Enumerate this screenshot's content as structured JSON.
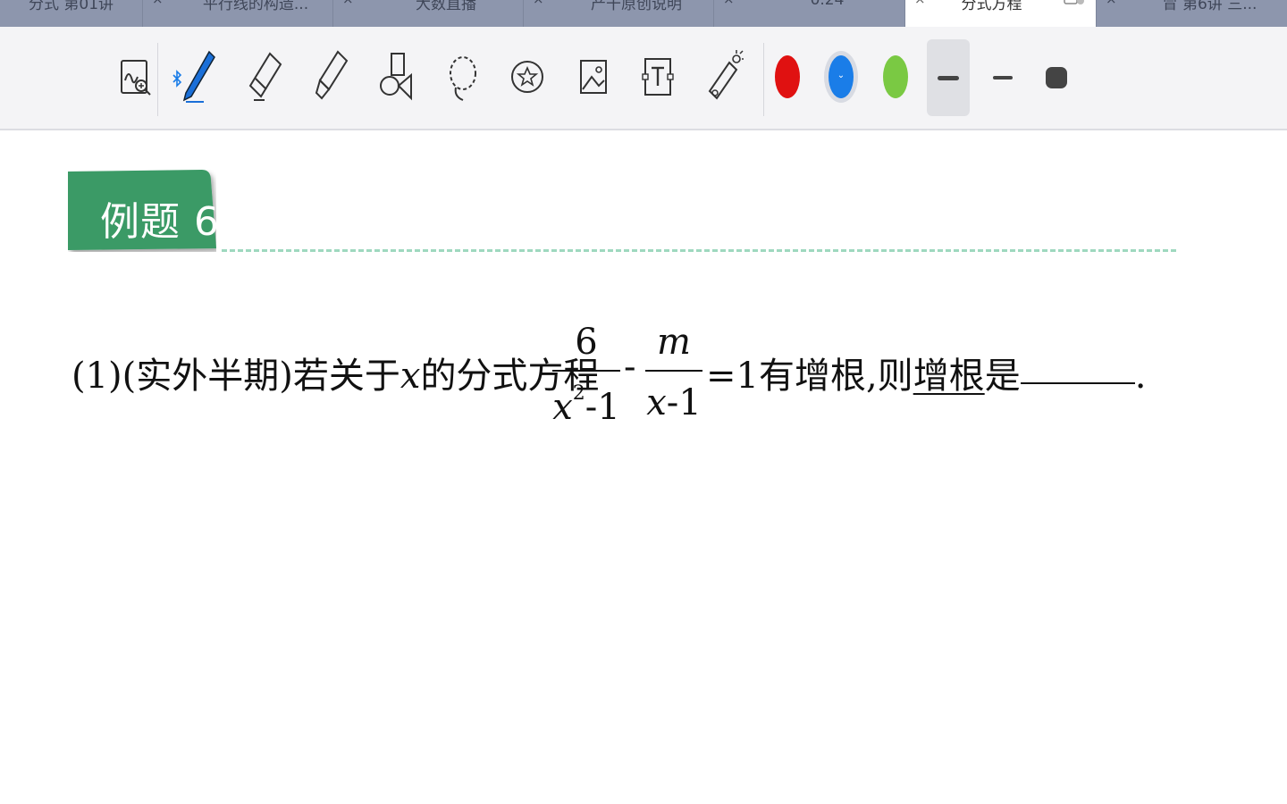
{
  "tabs": [
    {
      "label": "分式 第01讲",
      "close": "×"
    },
    {
      "label": "平行线的构造...",
      "close": "×"
    },
    {
      "label": "大数直播",
      "close": "×"
    },
    {
      "label": "产干原创说明",
      "close": "×"
    },
    {
      "label": "0.24",
      "close": "×"
    },
    {
      "label": "分式方程",
      "close": "×",
      "active": true
    },
    {
      "label": "冒 第6讲 三...",
      "close": "×"
    }
  ],
  "toolbar": {
    "tools": [
      {
        "name": "magnify-handwriting-icon"
      },
      {
        "name": "pen-icon"
      },
      {
        "name": "eraser-icon"
      },
      {
        "name": "highlighter-icon"
      },
      {
        "name": "shapes-icon"
      },
      {
        "name": "lasso-icon"
      },
      {
        "name": "sticker-icon"
      },
      {
        "name": "image-icon"
      },
      {
        "name": "text-box-icon"
      },
      {
        "name": "laser-pointer-icon"
      }
    ],
    "colors": [
      "#e01111",
      "#1a7de8",
      "#7ac943"
    ],
    "selected_color_mark": "⌄",
    "stroke_colors": {
      "bar": "#444444"
    }
  },
  "document": {
    "banner": {
      "text": "例题 6",
      "color": "#3a9a66"
    },
    "problem": {
      "prefix": "(1)(实外半期)若关于",
      "var_x": "x",
      "mid": "的分式方程",
      "frac1_num": "6",
      "frac1_den_var": "x",
      "frac1_den_sup": "2",
      "frac1_den_rest": "-1",
      "minus": "-",
      "frac2_num": "m",
      "frac2_den_var": "x",
      "frac2_den_rest": "-1",
      "eq": "=1有增根,则",
      "underlined": "增根",
      "suffix": "是",
      "period": "."
    }
  }
}
